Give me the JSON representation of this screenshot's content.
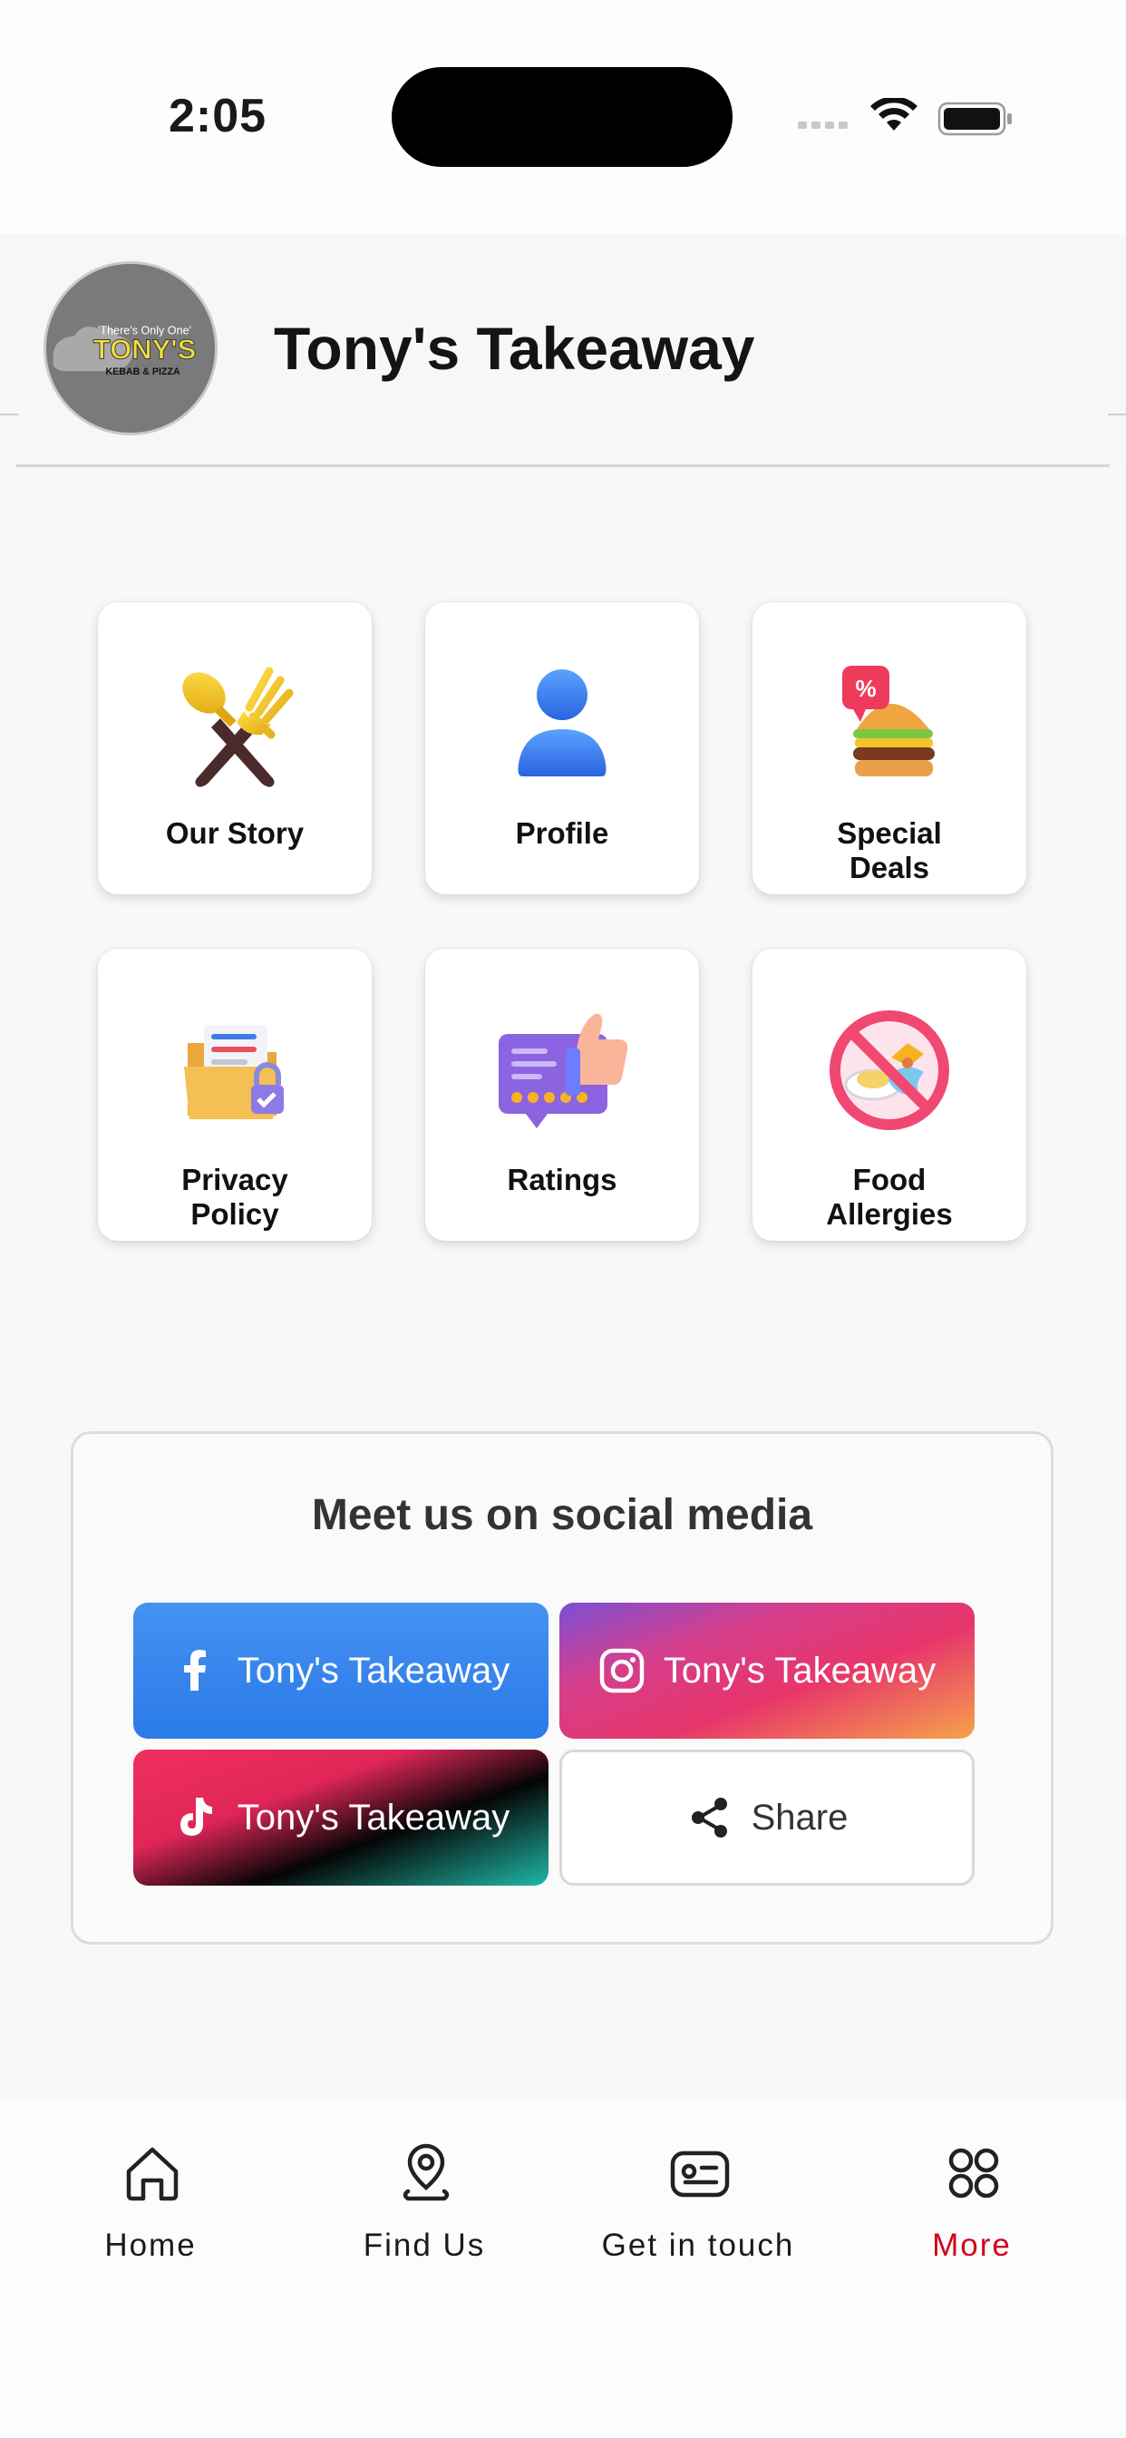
{
  "status_bar": {
    "time": "2:05"
  },
  "header": {
    "title": "Tony's Takeaway"
  },
  "logo": {
    "tagline": "There's Only One",
    "name": "TONY'S",
    "subtitle": "KEBAB & PIZZA"
  },
  "tiles": [
    {
      "label": "Our Story",
      "icon": "fork-spoon-icon"
    },
    {
      "label": "Profile",
      "icon": "user-icon"
    },
    {
      "label": "Special Deals",
      "icon": "burger-discount-icon"
    },
    {
      "label": "Privacy Policy",
      "icon": "folder-lock-icon"
    },
    {
      "label": "Ratings",
      "icon": "rating-thumbs-up-icon"
    },
    {
      "label": "Food Allergies",
      "icon": "no-allergen-icon"
    }
  ],
  "social": {
    "title": "Meet us on social media",
    "facebook_label": "Tony's Takeaway",
    "instagram_label": "Tony's Takeaway",
    "tiktok_label": "Tony's Takeaway",
    "share_label": "Share"
  },
  "tabbar": {
    "items": [
      {
        "label": "Home",
        "icon": "home-icon"
      },
      {
        "label": "Find Us",
        "icon": "location-pin-icon"
      },
      {
        "label": "Get in touch",
        "icon": "contact-card-icon"
      },
      {
        "label": "More",
        "icon": "grid-icon"
      }
    ],
    "active_color": "#d0021b"
  }
}
